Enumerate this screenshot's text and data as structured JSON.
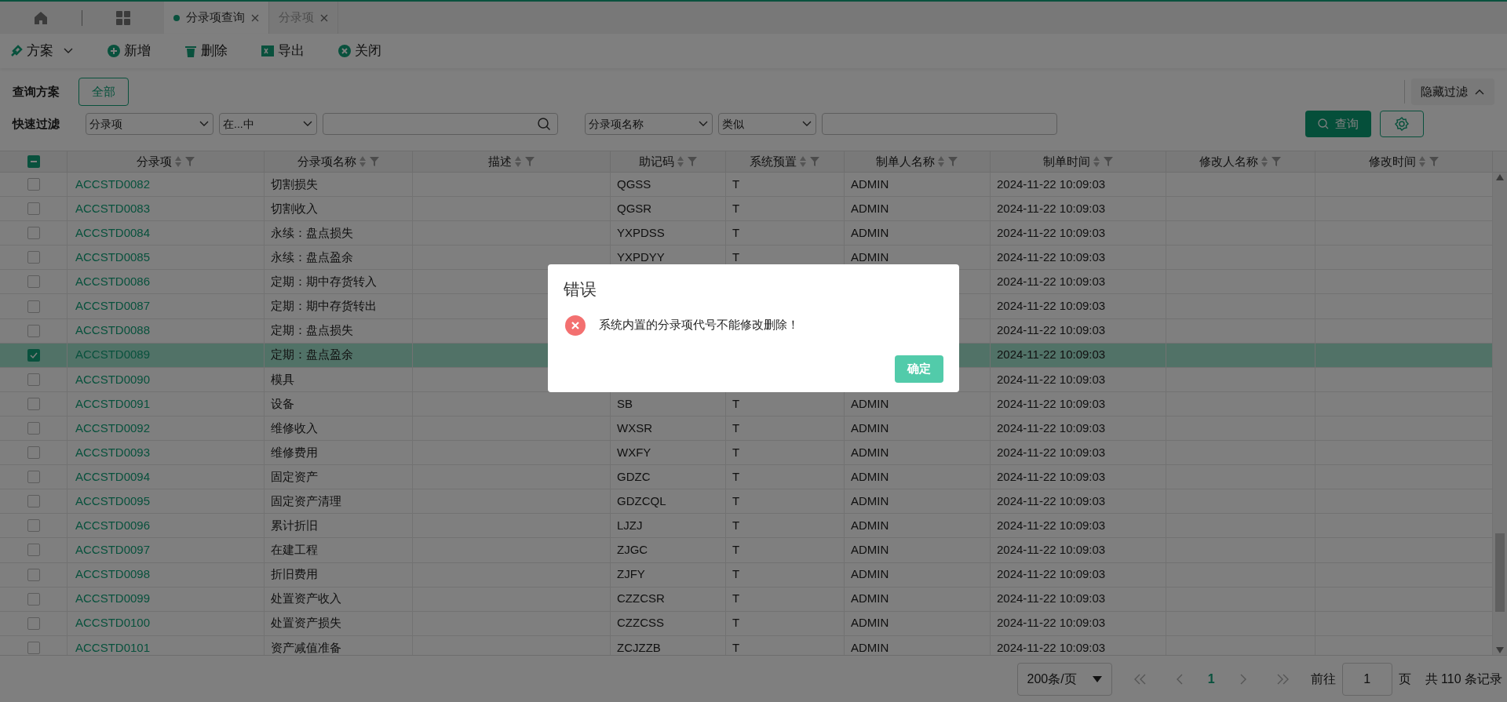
{
  "tabs": [
    {
      "label": "分录项查询",
      "selected": true
    },
    {
      "label": "分录项",
      "selected": false
    }
  ],
  "toolbar": [
    {
      "kind": "plan",
      "label": "方案"
    },
    {
      "kind": "add",
      "label": "新增"
    },
    {
      "kind": "delete",
      "label": "删除"
    },
    {
      "kind": "export",
      "label": "导出"
    },
    {
      "kind": "close",
      "label": "关闭"
    }
  ],
  "filter": {
    "scheme_label": "查询方案",
    "scheme_button": "全部",
    "hide_filter": "隐藏过滤",
    "quick_label": "快速过滤",
    "field1": "分录项",
    "op1": "在...中",
    "field2": "分录项名称",
    "op2": "类似",
    "query_button": "查询"
  },
  "table": {
    "columns": [
      "分录项",
      "分录项名称",
      "描述",
      "助记码",
      "系统预置",
      "制单人名称",
      "制单时间",
      "修改人名称",
      "修改时间"
    ],
    "header_checkbox_indeterminate": true,
    "rows": [
      {
        "code": "ACCSTD0082",
        "name": "切割损失",
        "help": "QGSS",
        "preset": "T",
        "creator": "ADMIN",
        "created": "2024-11-22 10:09:03",
        "selected": false
      },
      {
        "code": "ACCSTD0083",
        "name": "切割收入",
        "help": "QGSR",
        "preset": "T",
        "creator": "ADMIN",
        "created": "2024-11-22 10:09:03",
        "selected": false
      },
      {
        "code": "ACCSTD0084",
        "name": "永续：盘点损失",
        "help": "YXPDSS",
        "preset": "T",
        "creator": "ADMIN",
        "created": "2024-11-22 10:09:03",
        "selected": false
      },
      {
        "code": "ACCSTD0085",
        "name": "永续：盘点盈余",
        "help": "YXPDYY",
        "preset": "T",
        "creator": "ADMIN",
        "created": "2024-11-22 10:09:03",
        "selected": false
      },
      {
        "code": "ACCSTD0086",
        "name": "定期：期中存货转入",
        "created": "2024-11-22 10:09:03",
        "selected": false
      },
      {
        "code": "ACCSTD0087",
        "name": "定期：期中存货转出",
        "created": "2024-11-22 10:09:03",
        "selected": false
      },
      {
        "code": "ACCSTD0088",
        "name": "定期：盘点损失",
        "created": "2024-11-22 10:09:03",
        "selected": false
      },
      {
        "code": "ACCSTD0089",
        "name": "定期：盘点盈余",
        "created": "2024-11-22 10:09:03",
        "selected": true
      },
      {
        "code": "ACCSTD0090",
        "name": "模具",
        "created": "2024-11-22 10:09:03",
        "selected": false
      },
      {
        "code": "ACCSTD0091",
        "name": "设备",
        "help": "SB",
        "preset": "T",
        "creator": "ADMIN",
        "created": "2024-11-22 10:09:03",
        "selected": false
      },
      {
        "code": "ACCSTD0092",
        "name": "维修收入",
        "help": "WXSR",
        "preset": "T",
        "creator": "ADMIN",
        "created": "2024-11-22 10:09:03",
        "selected": false
      },
      {
        "code": "ACCSTD0093",
        "name": "维修费用",
        "help": "WXFY",
        "preset": "T",
        "creator": "ADMIN",
        "created": "2024-11-22 10:09:03",
        "selected": false
      },
      {
        "code": "ACCSTD0094",
        "name": "固定资产",
        "help": "GDZC",
        "preset": "T",
        "creator": "ADMIN",
        "created": "2024-11-22 10:09:03",
        "selected": false
      },
      {
        "code": "ACCSTD0095",
        "name": "固定资产清理",
        "help": "GDZCQL",
        "preset": "T",
        "creator": "ADMIN",
        "created": "2024-11-22 10:09:03",
        "selected": false
      },
      {
        "code": "ACCSTD0096",
        "name": "累计折旧",
        "help": "LJZJ",
        "preset": "T",
        "creator": "ADMIN",
        "created": "2024-11-22 10:09:03",
        "selected": false
      },
      {
        "code": "ACCSTD0097",
        "name": "在建工程",
        "help": "ZJGC",
        "preset": "T",
        "creator": "ADMIN",
        "created": "2024-11-22 10:09:03",
        "selected": false
      },
      {
        "code": "ACCSTD0098",
        "name": "折旧费用",
        "help": "ZJFY",
        "preset": "T",
        "creator": "ADMIN",
        "created": "2024-11-22 10:09:03",
        "selected": false
      },
      {
        "code": "ACCSTD0099",
        "name": "处置资产收入",
        "help": "CZZCSR",
        "preset": "T",
        "creator": "ADMIN",
        "created": "2024-11-22 10:09:03",
        "selected": false
      },
      {
        "code": "ACCSTD0100",
        "name": "处置资产损失",
        "help": "CZZCSS",
        "preset": "T",
        "creator": "ADMIN",
        "created": "2024-11-22 10:09:03",
        "selected": false
      },
      {
        "code": "ACCSTD0101",
        "name": "资产减值准备",
        "help": "ZCJZZB",
        "preset": "T",
        "creator": "ADMIN",
        "created": "2024-11-22 10:09:03",
        "selected": false
      }
    ]
  },
  "pagination": {
    "page_size": "200条/页",
    "pages": [
      {
        "label": "1",
        "selected": true
      }
    ],
    "goto_label": "前往",
    "goto_value": "1",
    "page_unit": "页",
    "total": "共 110 条记录"
  },
  "dialog": {
    "title": "错误",
    "message": "系统内置的分录项代号不能修改删除！",
    "ok": "确定"
  }
}
